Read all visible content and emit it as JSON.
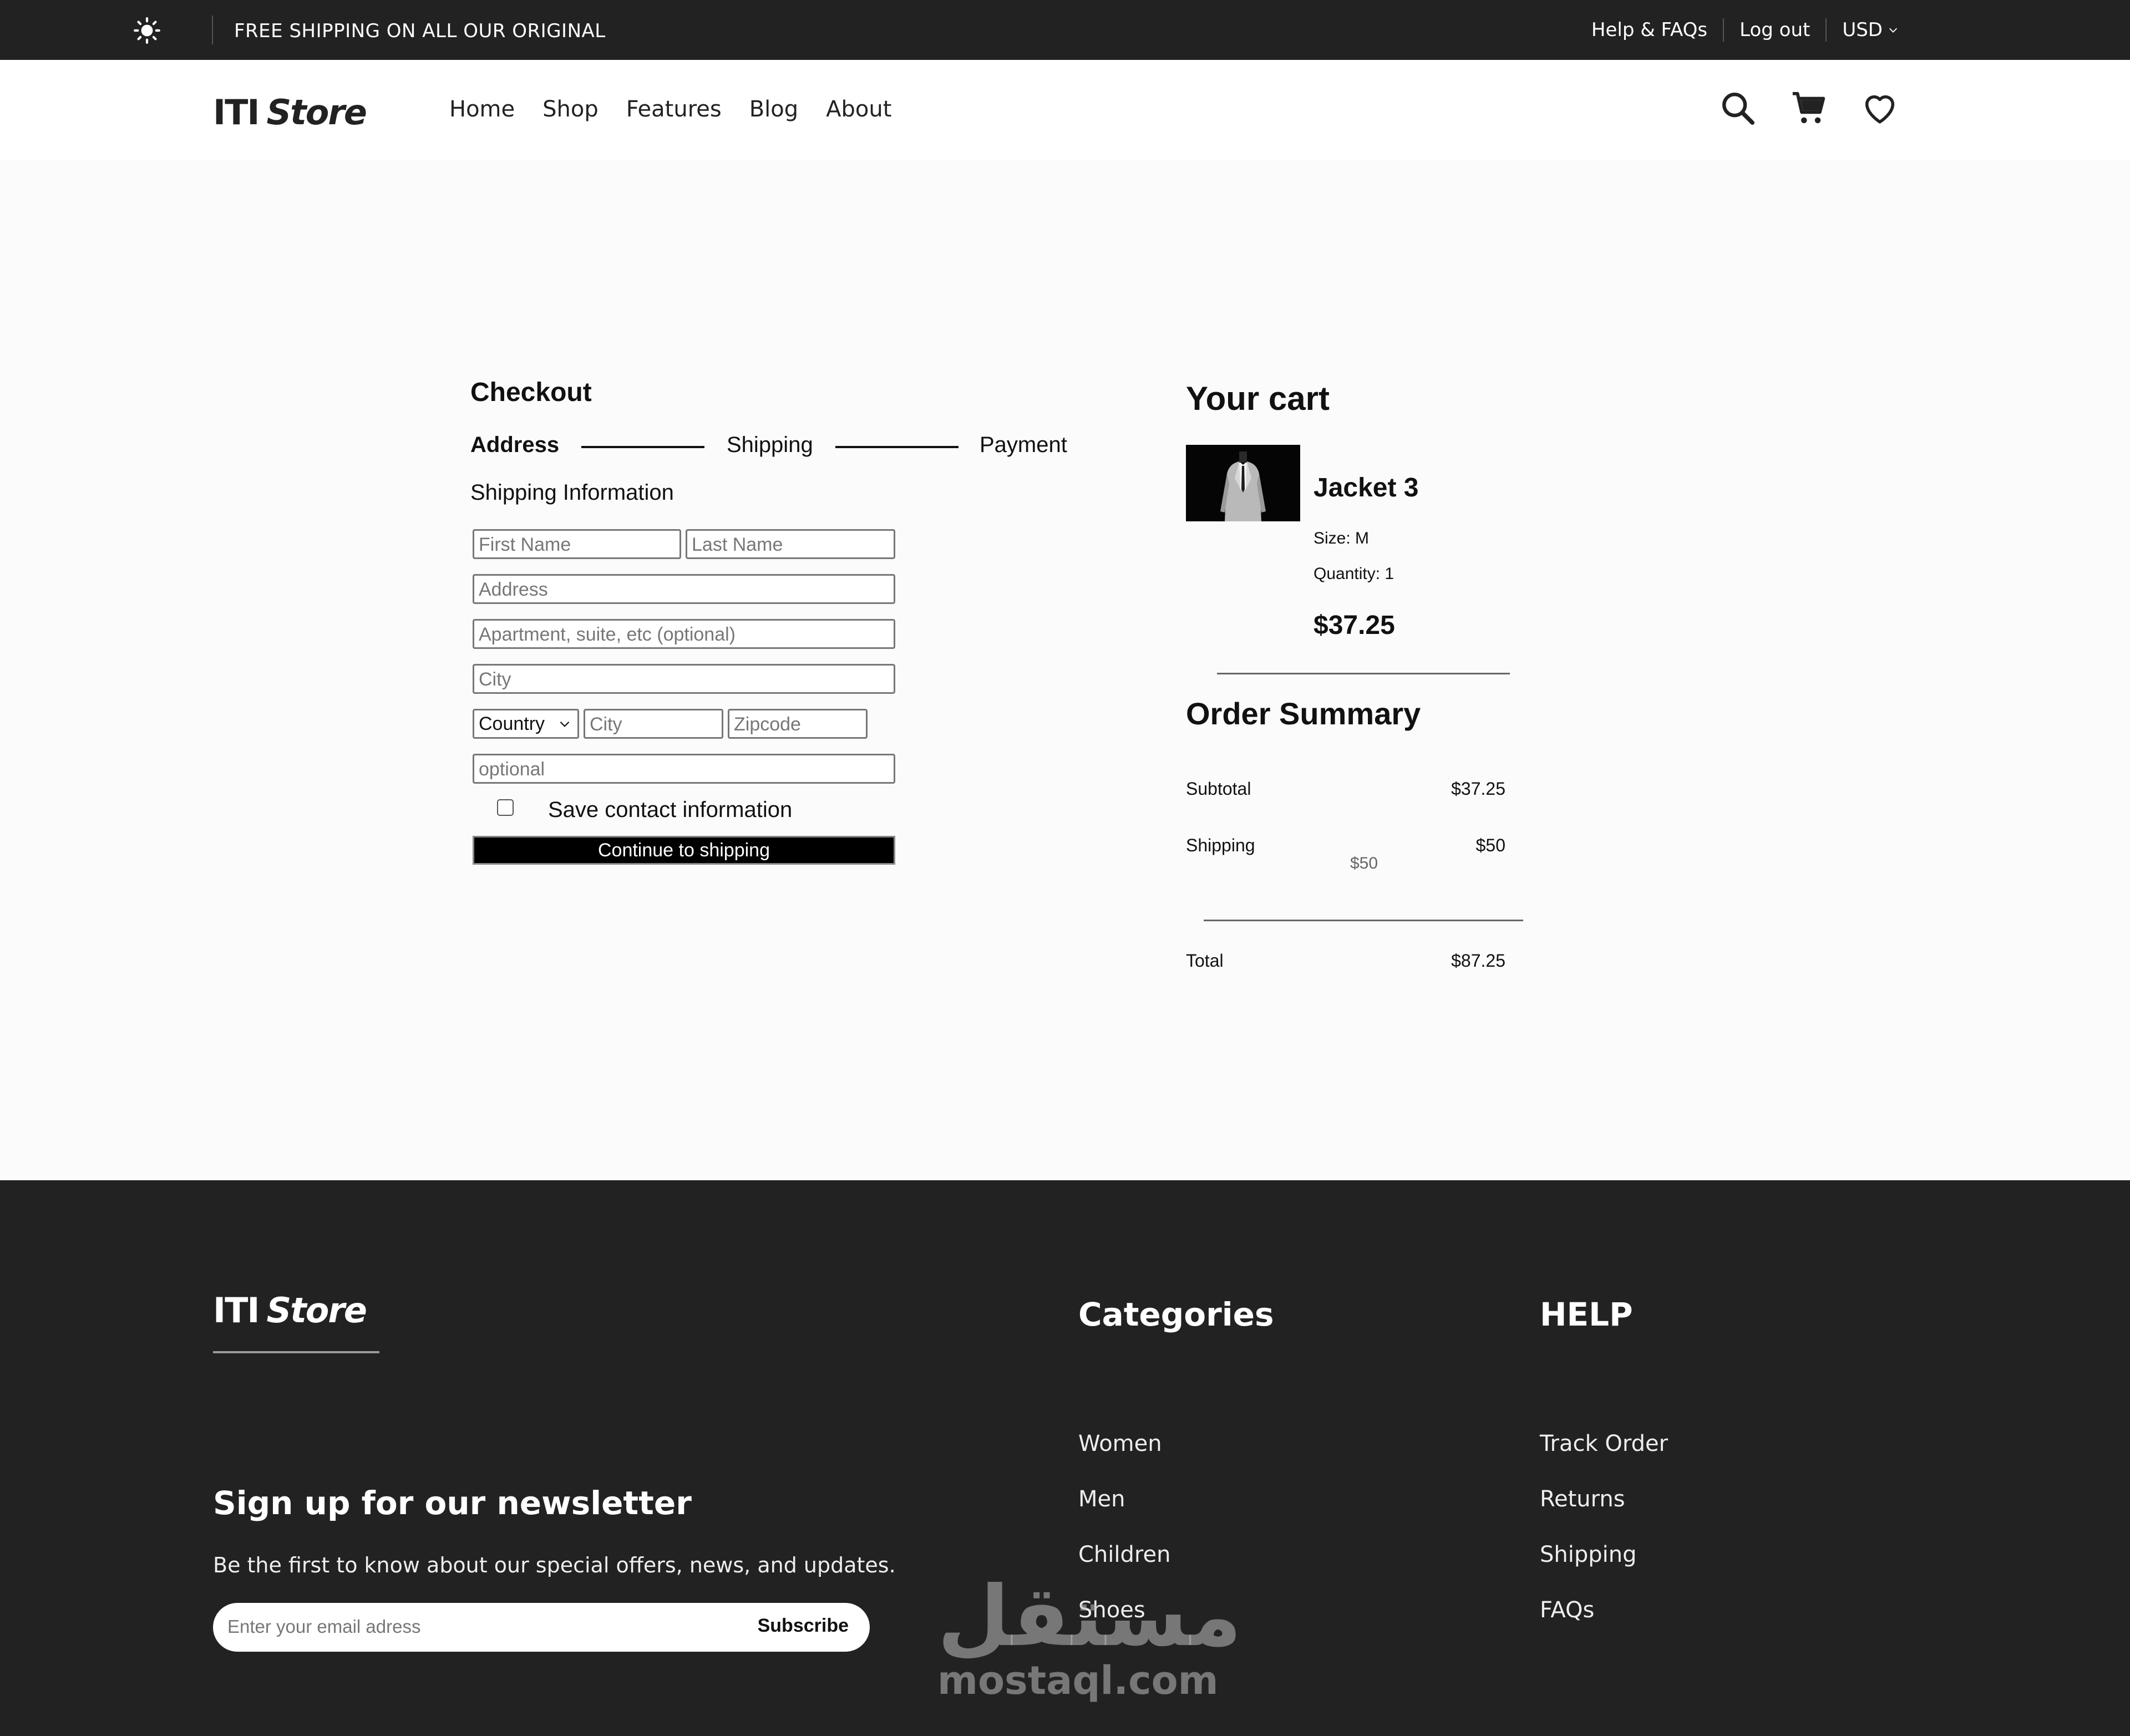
{
  "topbar": {
    "promo": "FREE SHIPPING ON ALL OUR ORIGINAL",
    "help": "Help & FAQs",
    "logout": "Log out",
    "currency": "USD"
  },
  "header": {
    "logo_iti": "ITI",
    "logo_store": "Store",
    "nav": [
      "Home",
      "Shop",
      "Features",
      "Blog",
      "About"
    ]
  },
  "checkout": {
    "title": "Checkout",
    "steps": [
      "Address",
      "Shipping",
      "Payment"
    ],
    "section_title": "Shipping Information",
    "placeholders": {
      "first_name": "First Name",
      "last_name": "Last Name",
      "address": "Address",
      "apartment": "Apartment, suite, etc (optional)",
      "city": "City",
      "country": "Country",
      "city2": "City",
      "zipcode": "Zipcode",
      "optional": "optional"
    },
    "save_contact": "Save contact information",
    "continue_button": "Continue to shipping"
  },
  "cart": {
    "title": "Your cart",
    "item": {
      "name": "Jacket 3",
      "size": "Size: M",
      "quantity": "Quantity: 1",
      "price": "$37.25"
    }
  },
  "summary": {
    "title": "Order Summary",
    "subtotal_label": "Subtotal",
    "subtotal_value": "$37.25",
    "shipping_label": "Shipping",
    "shipping_value": "$50",
    "shipping_sub": "$50",
    "total_label": "Total",
    "total_value": "$87.25"
  },
  "footer": {
    "logo_iti": "ITI",
    "logo_store": "Store",
    "newsletter_title": "Sign up for our newsletter",
    "newsletter_desc": "Be the first to know about our special offers, news, and updates.",
    "email_placeholder": "Enter your email adress",
    "subscribe": "Subscribe",
    "categories_title": "Categories",
    "categories": [
      "Women",
      "Men",
      "Children",
      "Shoes"
    ],
    "help_title": "HELP",
    "help_links": [
      "Track Order",
      "Returns",
      "Shipping",
      "FAQs"
    ]
  },
  "watermark": {
    "arabic": "مستقل",
    "latin": "mostaql.com"
  }
}
